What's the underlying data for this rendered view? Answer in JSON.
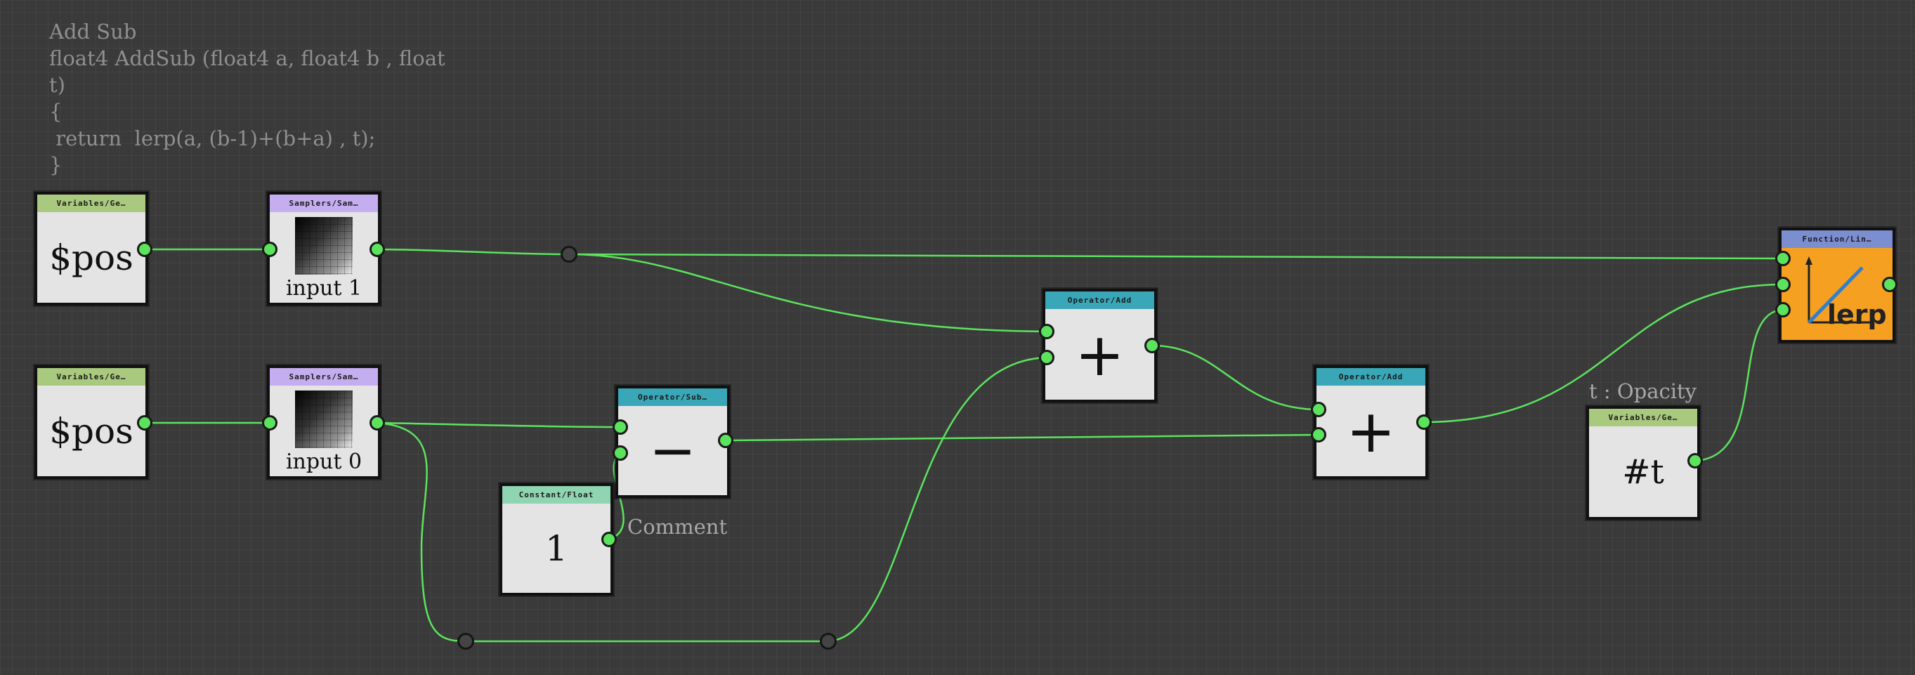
{
  "code_comment": "Add Sub\nfloat4 AddSub (float4 a, float4 b , float\nt)\n{\n return  lerp(a, (b-1)+(b+a) , t);\n}",
  "nodes": {
    "var_pos_top": {
      "header": "Variables/Ge…",
      "value": "$pos"
    },
    "var_pos_bottom": {
      "header": "Variables/Ge…",
      "value": "$pos"
    },
    "sampler_top": {
      "header": "Samplers/Sam…",
      "label": "input 1"
    },
    "sampler_bottom": {
      "header": "Samplers/Sam…",
      "label": "input 0"
    },
    "op_sub": {
      "header": "Operator/Sub…",
      "symbol": "−"
    },
    "const_float": {
      "header": "Constant/Float",
      "value": "1"
    },
    "op_add_1": {
      "header": "Operator/Add",
      "symbol": "+"
    },
    "op_add_2": {
      "header": "Operator/Add",
      "symbol": "+"
    },
    "var_t": {
      "header": "Variables/Ge…",
      "value": "#t"
    },
    "func_lerp": {
      "header": "Function/Lin…",
      "value": "lerp"
    }
  },
  "labels": {
    "comment": "Comment",
    "t_opacity": "t : Opacity"
  },
  "colors": {
    "wire": "#5ce35e",
    "canvas": "#3a3a3a",
    "variables_header": "#a9c97e",
    "samplers_header": "#c4aef0",
    "operator_header": "#3aa7b8",
    "constant_header": "#8fd5b2",
    "function_header": "#7a8ed0",
    "lerp_body": "#f5a020"
  }
}
